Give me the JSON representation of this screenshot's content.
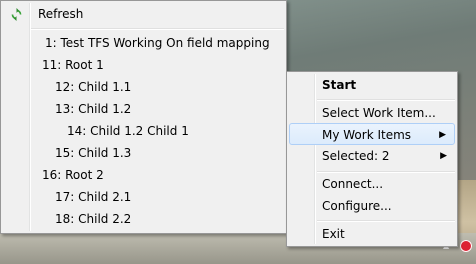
{
  "left_menu": {
    "refresh_label": "Refresh",
    "items": [
      "1: Test TFS Working On field mapping",
      "11: Root 1",
      "12: Child 1.1",
      "13: Child 1.2",
      "14: Child 1.2 Child 1",
      "15: Child 1.3",
      "16: Root 2",
      "17: Child 2.1",
      "18: Child 2.2"
    ]
  },
  "right_menu": {
    "start": "Start",
    "select_work_item": "Select Work Item...",
    "my_work_items": "My Work Items",
    "selected": "Selected: 2",
    "connect": "Connect...",
    "configure": "Configure...",
    "exit": "Exit"
  },
  "icons": {
    "refresh": "refresh-icon",
    "submenu_arrow": "chevron-right-icon",
    "tray_app": "tray-app-icon",
    "tray_expand": "chevron-up-icon"
  },
  "colors": {
    "menu_bg": "#f0f0f0",
    "highlight_border": "#aecff7",
    "refresh_green": "#3aa33a"
  }
}
